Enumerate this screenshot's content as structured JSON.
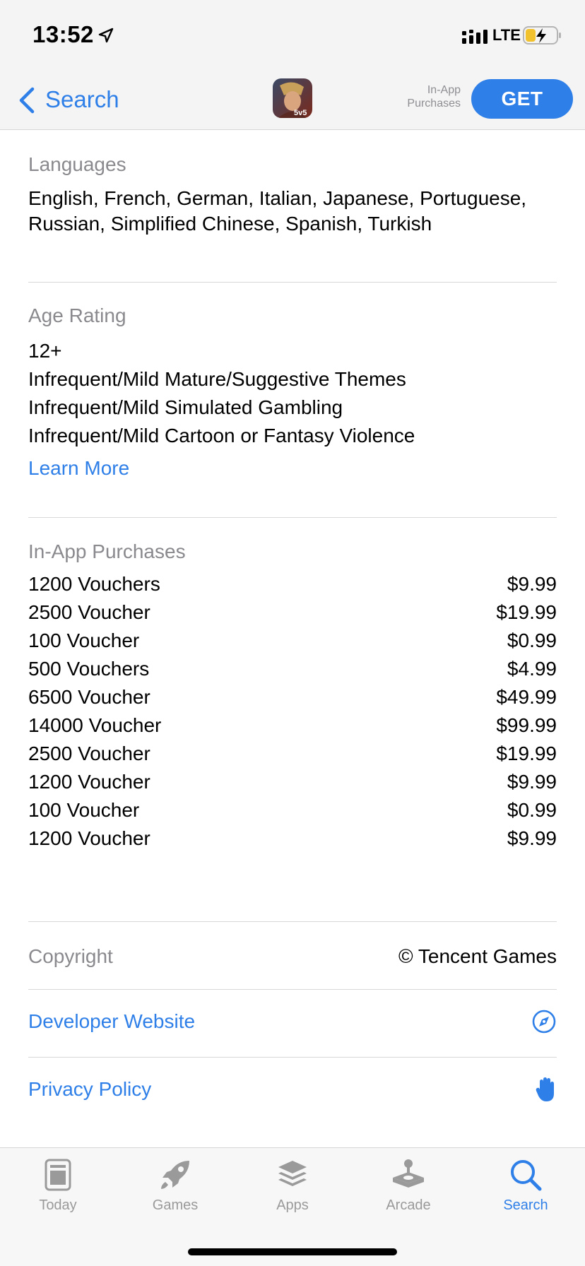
{
  "status": {
    "time": "13:52",
    "network": "LTE"
  },
  "nav": {
    "back_label": "Search",
    "iap_hint_line1": "In-App",
    "iap_hint_line2": "Purchases",
    "get_label": "GET",
    "app_icon_badge": "5v5"
  },
  "languages": {
    "label": "Languages",
    "value": "English, French, German, Italian, Japanese, Portuguese, Russian, Simplified Chinese, Spanish, Turkish"
  },
  "age_rating": {
    "label": "Age Rating",
    "lines": [
      "12+",
      "Infrequent/Mild Mature/Suggestive Themes",
      "Infrequent/Mild Simulated Gambling",
      "Infrequent/Mild Cartoon or Fantasy Violence"
    ],
    "learn_more": "Learn More"
  },
  "iap": {
    "label": "In-App Purchases",
    "items": [
      {
        "name": "1200 Vouchers",
        "price": "$9.99"
      },
      {
        "name": "2500 Voucher",
        "price": "$19.99"
      },
      {
        "name": "100 Voucher",
        "price": "$0.99"
      },
      {
        "name": "500 Vouchers",
        "price": "$4.99"
      },
      {
        "name": "6500 Voucher",
        "price": "$49.99"
      },
      {
        "name": "14000 Voucher",
        "price": "$99.99"
      },
      {
        "name": "2500 Voucher",
        "price": "$19.99"
      },
      {
        "name": "1200 Voucher",
        "price": "$9.99"
      },
      {
        "name": "100 Voucher",
        "price": "$0.99"
      },
      {
        "name": "1200 Voucher",
        "price": "$9.99"
      }
    ]
  },
  "copyright": {
    "label": "Copyright",
    "value": "© Tencent Games"
  },
  "developer_website": {
    "label": "Developer Website",
    "icon": "compass-icon"
  },
  "privacy_policy": {
    "label": "Privacy Policy",
    "icon": "hand-icon"
  },
  "tabs": [
    {
      "label": "Today",
      "icon": "today-icon"
    },
    {
      "label": "Games",
      "icon": "rocket-icon"
    },
    {
      "label": "Apps",
      "icon": "layers-icon"
    },
    {
      "label": "Arcade",
      "icon": "joystick-icon"
    },
    {
      "label": "Search",
      "icon": "search-icon",
      "active": true
    }
  ],
  "colors": {
    "accent": "#2f7fe8",
    "secondary_text": "#8a8a8e"
  }
}
